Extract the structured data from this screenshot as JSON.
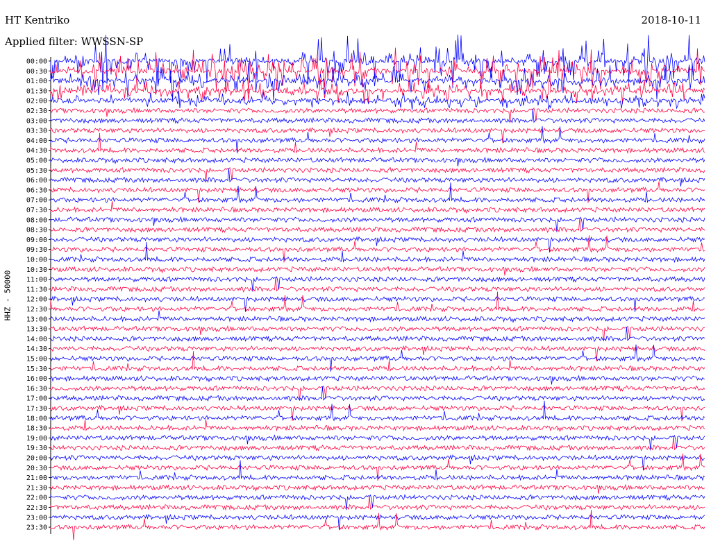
{
  "header": {
    "station": "HT Kentriko",
    "date": "2018-10-11",
    "filter": "Applied filter: WWSSN-SP"
  },
  "colors": {
    "trace_a": "#0000ff",
    "trace_b": "#ff0040",
    "axis": "#000000",
    "background": "#ffffff"
  },
  "chart_data": {
    "type": "line",
    "title": "HT Kentriko",
    "subtitle": "Applied filter: WWSSN-SP",
    "date": "2018-10-11",
    "ylabel": "HHZ - 50000",
    "xlabel": "",
    "row_labels": [
      "00:00",
      "00:30",
      "01:00",
      "01:30",
      "02:00",
      "02:30",
      "03:00",
      "03:30",
      "04:00",
      "04:30",
      "05:00",
      "05:30",
      "06:00",
      "06:30",
      "07:00",
      "07:30",
      "08:00",
      "08:30",
      "09:00",
      "09:30",
      "10:00",
      "10:30",
      "11:00",
      "11:30",
      "12:00",
      "12:30",
      "13:00",
      "13:30",
      "14:00",
      "14:30",
      "15:00",
      "15:30",
      "16:00",
      "16:30",
      "17:00",
      "17:30",
      "18:00",
      "18:30",
      "19:00",
      "19:30",
      "20:00",
      "20:30",
      "21:00",
      "21:30",
      "22:00",
      "22:30",
      "23:00",
      "23:30"
    ],
    "series": [
      {
        "color": "#0000ff",
        "rows": "even"
      },
      {
        "color": "#ff0040",
        "rows": "odd"
      }
    ],
    "grid": false,
    "legend": "none"
  }
}
